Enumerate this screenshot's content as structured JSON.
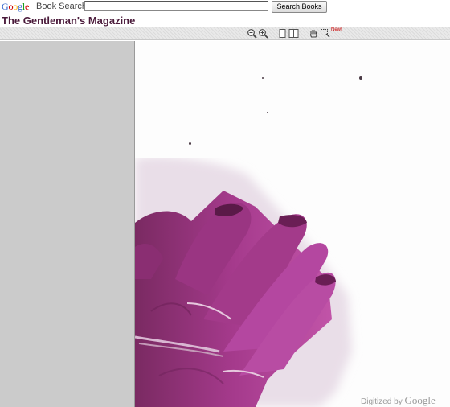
{
  "header": {
    "logo": {
      "letters": [
        "G",
        "o",
        "o",
        "g",
        "l",
        "e"
      ]
    },
    "product": "Book Search",
    "search": {
      "value": "",
      "placeholder": ""
    },
    "search_button": "Search Books"
  },
  "book": {
    "title": "The Gentleman's Magazine"
  },
  "toolbar": {
    "icons": [
      "zoom-out-icon",
      "zoom-in-icon",
      "single-page-icon",
      "two-page-icon",
      "hand-pan-icon",
      "clip-select-icon"
    ],
    "new_badge": "New!"
  },
  "page": {
    "watermark_prefix": "Digitized by",
    "watermark_brand": "Google"
  }
}
